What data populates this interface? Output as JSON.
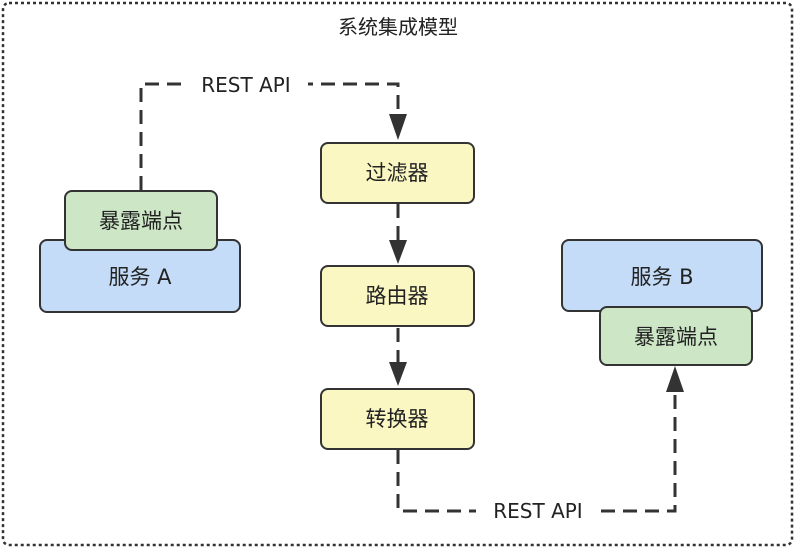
{
  "title": "系统集成模型",
  "colors": {
    "service_fill": "#c4dcf7",
    "endpoint_fill": "#cce6c6",
    "component_fill": "#fbf7c2",
    "stroke": "#333333"
  },
  "nodes": {
    "service_a": "服务 A",
    "endpoint_a": "暴露端点",
    "filter": "过滤器",
    "router": "路由器",
    "converter": "转换器",
    "service_b": "服务 B",
    "endpoint_b": "暴露端点"
  },
  "edges": {
    "top_label": "REST API",
    "bottom_label": "REST API"
  }
}
